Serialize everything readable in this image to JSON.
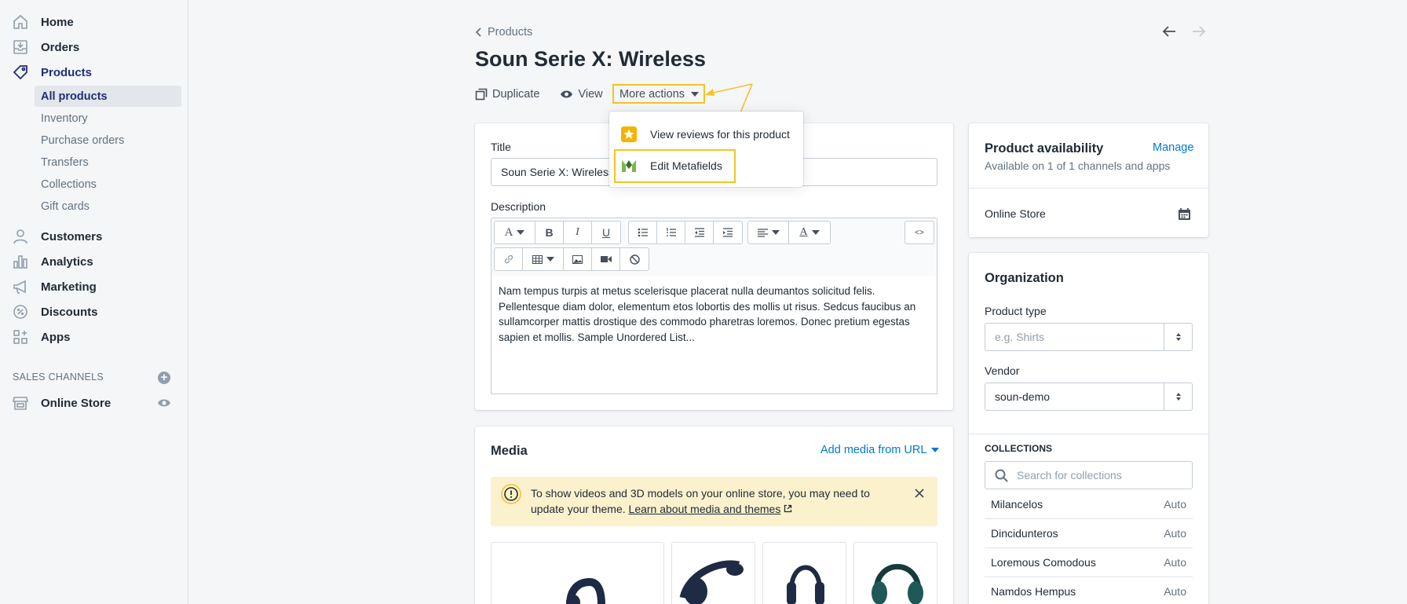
{
  "sidebar": {
    "items": [
      {
        "label": "Home",
        "icon": "home-icon"
      },
      {
        "label": "Orders",
        "icon": "orders-icon"
      },
      {
        "label": "Products",
        "icon": "tag-icon"
      },
      {
        "label": "Customers",
        "icon": "person-icon"
      },
      {
        "label": "Analytics",
        "icon": "bar-chart-icon"
      },
      {
        "label": "Marketing",
        "icon": "megaphone-icon"
      },
      {
        "label": "Discounts",
        "icon": "discount-icon"
      },
      {
        "label": "Apps",
        "icon": "apps-icon"
      }
    ],
    "product_subitems": [
      "All products",
      "Inventory",
      "Purchase orders",
      "Transfers",
      "Collections",
      "Gift cards"
    ],
    "sales_channels_header": "SALES CHANNELS",
    "online_store": "Online Store"
  },
  "header": {
    "breadcrumb": "Products",
    "title": "Soun Serie X: Wireless",
    "actions": {
      "duplicate": "Duplicate",
      "view": "View",
      "more": "More actions"
    }
  },
  "dropdown": {
    "items": [
      {
        "label": "View reviews for this product",
        "icon": "star-icon"
      },
      {
        "label": "Edit Metafields",
        "icon": "metafields-logo-icon"
      }
    ]
  },
  "product": {
    "title_label": "Title",
    "title_value": "Soun Serie X: Wireless",
    "description_label": "Description",
    "description_text": "Nam tempus turpis at metus scelerisque placerat nulla deumantos solicitud felis. Pellentesque diam dolor, elementum etos lobortis des mollis ut risus. Sedcus faucibus an sullamcorper mattis drostique des commodo pharetras loremos. Donec pretium egestas sapien et mollis. Sample Unordered List...",
    "editor_buttons": {
      "bold": "B",
      "italic": "I",
      "underline": "U",
      "code": "<>"
    }
  },
  "media": {
    "title": "Media",
    "add_link": "Add media from URL",
    "banner_text": "To show videos and 3D models on your online store, you may need to update your theme.",
    "banner_link": "Learn about media and themes"
  },
  "availability": {
    "title": "Product availability",
    "manage": "Manage",
    "subtitle": "Available on 1 of 1 channels and apps",
    "channel": "Online Store"
  },
  "organization": {
    "title": "Organization",
    "product_type_label": "Product type",
    "product_type_placeholder": "e.g. Shirts",
    "vendor_label": "Vendor",
    "vendor_value": "soun-demo",
    "collections_label": "COLLECTIONS",
    "collections_placeholder": "Search for collections",
    "collections": [
      {
        "name": "Milancelos",
        "mode": "Auto"
      },
      {
        "name": "Dincidunteros",
        "mode": "Auto"
      },
      {
        "name": "Loremous Comodous",
        "mode": "Auto"
      },
      {
        "name": "Namdos Hempus",
        "mode": "Auto"
      }
    ]
  },
  "colors": {
    "highlight": "#f6c325",
    "link": "#007ace",
    "nav_active": "#202e78"
  }
}
